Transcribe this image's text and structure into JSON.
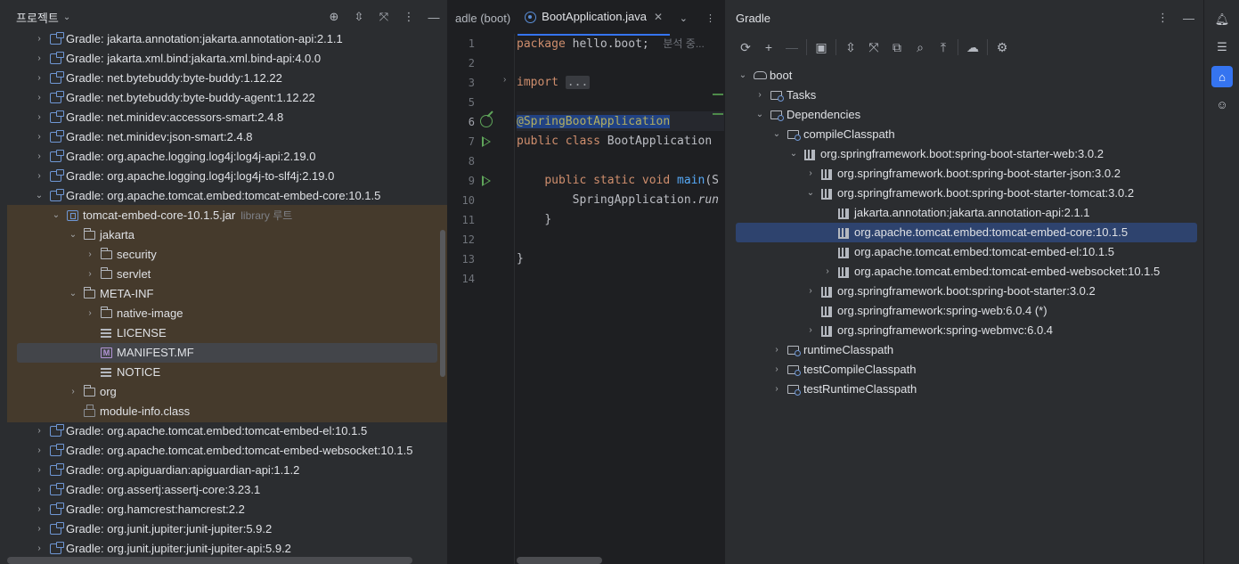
{
  "colors": {
    "accent": "#3574f0",
    "jar_highlight": "#4a3d2c",
    "gradle_selection": "#2e436e",
    "run_green": "#5fa55a"
  },
  "project": {
    "title": "프로젝트",
    "header_icons": [
      "crosshair-icon",
      "expand-icon",
      "collapse-icon",
      "more-icon",
      "minimize-icon"
    ],
    "rows": [
      {
        "indent": 0,
        "arrow": "›",
        "icon": "gradle",
        "label": "Gradle: jakarta.annotation:jakarta.annotation-api:2.1.1"
      },
      {
        "indent": 0,
        "arrow": "›",
        "icon": "gradle",
        "label": "Gradle: jakarta.xml.bind:jakarta.xml.bind-api:4.0.0"
      },
      {
        "indent": 0,
        "arrow": "›",
        "icon": "gradle",
        "label": "Gradle: net.bytebuddy:byte-buddy:1.12.22"
      },
      {
        "indent": 0,
        "arrow": "›",
        "icon": "gradle",
        "label": "Gradle: net.bytebuddy:byte-buddy-agent:1.12.22"
      },
      {
        "indent": 0,
        "arrow": "›",
        "icon": "gradle",
        "label": "Gradle: net.minidev:accessors-smart:2.4.8"
      },
      {
        "indent": 0,
        "arrow": "›",
        "icon": "gradle",
        "label": "Gradle: net.minidev:json-smart:2.4.8"
      },
      {
        "indent": 0,
        "arrow": "›",
        "icon": "gradle",
        "label": "Gradle: org.apache.logging.log4j:log4j-api:2.19.0"
      },
      {
        "indent": 0,
        "arrow": "›",
        "icon": "gradle",
        "label": "Gradle: org.apache.logging.log4j:log4j-to-slf4j:2.19.0"
      },
      {
        "indent": 0,
        "arrow": "⌄",
        "icon": "gradle",
        "label": "Gradle: org.apache.tomcat.embed:tomcat-embed-core:10.1.5"
      },
      {
        "indent": 1,
        "arrow": "⌄",
        "icon": "jar",
        "label": "tomcat-embed-core-10.1.5.jar",
        "extra": "library 루트"
      },
      {
        "indent": 2,
        "arrow": "⌄",
        "icon": "folder",
        "label": "jakarta"
      },
      {
        "indent": 3,
        "arrow": "›",
        "icon": "folder",
        "label": "security"
      },
      {
        "indent": 3,
        "arrow": "›",
        "icon": "folder",
        "label": "servlet"
      },
      {
        "indent": 2,
        "arrow": "⌄",
        "icon": "folder",
        "label": "META-INF"
      },
      {
        "indent": 3,
        "arrow": "›",
        "icon": "folder",
        "label": "native-image"
      },
      {
        "indent": 3,
        "arrow": "",
        "icon": "text",
        "label": "LICENSE"
      },
      {
        "indent": 3,
        "arrow": "",
        "icon": "mf",
        "label": "MANIFEST.MF"
      },
      {
        "indent": 3,
        "arrow": "",
        "icon": "text",
        "label": "NOTICE"
      },
      {
        "indent": 2,
        "arrow": "›",
        "icon": "folder",
        "label": "org"
      },
      {
        "indent": 2,
        "arrow": "",
        "icon": "class",
        "label": "module-info.class"
      },
      {
        "indent": 0,
        "arrow": "›",
        "icon": "gradle",
        "label": "Gradle: org.apache.tomcat.embed:tomcat-embed-el:10.1.5"
      },
      {
        "indent": 0,
        "arrow": "›",
        "icon": "gradle",
        "label": "Gradle: org.apache.tomcat.embed:tomcat-embed-websocket:10.1.5"
      },
      {
        "indent": 0,
        "arrow": "›",
        "icon": "gradle",
        "label": "Gradle: org.apiguardian:apiguardian-api:1.1.2"
      },
      {
        "indent": 0,
        "arrow": "›",
        "icon": "gradle",
        "label": "Gradle: org.assertj:assertj-core:3.23.1"
      },
      {
        "indent": 0,
        "arrow": "›",
        "icon": "gradle",
        "label": "Gradle: org.hamcrest:hamcrest:2.2"
      },
      {
        "indent": 0,
        "arrow": "›",
        "icon": "gradle",
        "label": "Gradle: org.junit.jupiter:junit-jupiter:5.9.2"
      },
      {
        "indent": 0,
        "arrow": "›",
        "icon": "gradle",
        "label": "Gradle: org.junit.jupiter:junit-jupiter-api:5.9.2"
      }
    ]
  },
  "editor": {
    "tab_partial": "adle (boot)",
    "tab_active": "BootApplication.java",
    "line_numbers": [
      "1",
      "2",
      "3",
      "5",
      "6",
      "7",
      "8",
      "9",
      "10",
      "11",
      "12",
      "13",
      "14"
    ],
    "current_line": "6",
    "code": {
      "l1_kw": "package",
      "l1_rest": " hello.boot;",
      "l1_hint": "분석 중...",
      "l3_kw": "import",
      "l3_collapsed": "...",
      "l6_ann": "@SpringBootApplication",
      "l7_kw": "public class",
      "l7_rest": " BootApplication",
      "l9_kw": "public static void",
      "l9_fn": "main",
      "l9_rest": "(S",
      "l10_rest": "SpringApplication.",
      "l10_it": "run",
      "l11": "}",
      "l13": "}"
    }
  },
  "gradle": {
    "title": "Gradle",
    "toolbar_icons": [
      "refresh-icon",
      "add-icon",
      "remove-icon",
      "run-task-icon",
      "expand-all-icon",
      "collapse-all-icon",
      "link-icon",
      "analyze-icon",
      "toggle-offline-icon",
      "offline-icon",
      "settings-icon"
    ],
    "rows": [
      {
        "indent": 0,
        "arrow": "⌄",
        "icon": "elephant",
        "label": "boot"
      },
      {
        "indent": 1,
        "arrow": "›",
        "icon": "cfg",
        "label": "Tasks"
      },
      {
        "indent": 1,
        "arrow": "⌄",
        "icon": "cfg",
        "label": "Dependencies"
      },
      {
        "indent": 2,
        "arrow": "⌄",
        "icon": "cfg",
        "label": "compileClasspath"
      },
      {
        "indent": 3,
        "arrow": "⌄",
        "icon": "lib",
        "label": "org.springframework.boot:spring-boot-starter-web:3.0.2"
      },
      {
        "indent": 4,
        "arrow": "›",
        "icon": "lib",
        "label": "org.springframework.boot:spring-boot-starter-json:3.0.2"
      },
      {
        "indent": 4,
        "arrow": "⌄",
        "icon": "lib",
        "label": "org.springframework.boot:spring-boot-starter-tomcat:3.0.2"
      },
      {
        "indent": 5,
        "arrow": "",
        "icon": "lib",
        "label": "jakarta.annotation:jakarta.annotation-api:2.1.1"
      },
      {
        "indent": 5,
        "arrow": "",
        "icon": "lib",
        "label": "org.apache.tomcat.embed:tomcat-embed-core:10.1.5"
      },
      {
        "indent": 5,
        "arrow": "",
        "icon": "lib",
        "label": "org.apache.tomcat.embed:tomcat-embed-el:10.1.5"
      },
      {
        "indent": 5,
        "arrow": "›",
        "icon": "lib",
        "label": "org.apache.tomcat.embed:tomcat-embed-websocket:10.1.5"
      },
      {
        "indent": 4,
        "arrow": "›",
        "icon": "lib",
        "label": "org.springframework.boot:spring-boot-starter:3.0.2"
      },
      {
        "indent": 4,
        "arrow": "",
        "icon": "lib",
        "label": "org.springframework:spring-web:6.0.4 (*)"
      },
      {
        "indent": 4,
        "arrow": "›",
        "icon": "lib",
        "label": "org.springframework:spring-webmvc:6.0.4"
      },
      {
        "indent": 2,
        "arrow": "›",
        "icon": "cfg",
        "label": "runtimeClasspath"
      },
      {
        "indent": 2,
        "arrow": "›",
        "icon": "cfg",
        "label": "testCompileClasspath"
      },
      {
        "indent": 2,
        "arrow": "›",
        "icon": "cfg",
        "label": "testRuntimeClasspath"
      }
    ]
  },
  "strip": {
    "buttons": [
      "notifications-icon",
      "database-icon",
      "gradle-icon",
      "copilot-icon"
    ]
  }
}
